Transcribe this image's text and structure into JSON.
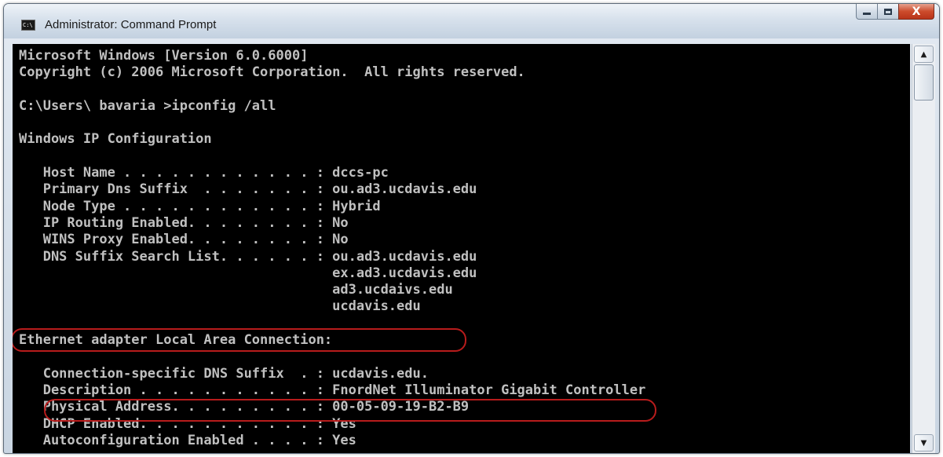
{
  "window": {
    "title": "Administrator: Command Prompt",
    "icon_label": "C:\\",
    "buttons": {
      "minimize": "minimize",
      "maximize": "maximize",
      "close": "X"
    }
  },
  "console": {
    "lines": [
      "Microsoft Windows [Version 6.0.6000]",
      "Copyright (c) 2006 Microsoft Corporation.  All rights reserved.",
      "",
      "C:\\Users\\ bavaria >ipconfig /all",
      "",
      "Windows IP Configuration",
      "",
      "   Host Name . . . . . . . . . . . . : dccs-pc",
      "   Primary Dns Suffix  . . . . . . . : ou.ad3.ucdavis.edu",
      "   Node Type . . . . . . . . . . . . : Hybrid",
      "   IP Routing Enabled. . . . . . . . : No",
      "   WINS Proxy Enabled. . . . . . . . : No",
      "   DNS Suffix Search List. . . . . . : ou.ad3.ucdavis.edu",
      "                                       ex.ad3.ucdavis.edu",
      "                                       ad3.ucdaivs.edu",
      "                                       ucdavis.edu",
      "",
      "Ethernet adapter Local Area Connection:",
      "",
      "   Connection-specific DNS Suffix  . : ucdavis.edu.",
      "   Description . . . . . . . . . . . : FnordNet Illuminator Gigabit Controller",
      "   Physical Address. . . . . . . . . : 00-05-09-19-B2-B9",
      "   DHCP Enabled. . . . . . . . . . . : Yes",
      "   Autoconfiguration Enabled . . . . : Yes"
    ],
    "highlighted_lines": [
      "Ethernet adapter Local Area Connection:",
      "Physical Address. . . . . . . . . : 00-05-09-19-B2-B9"
    ],
    "text_color": "#c0c0c0",
    "background_color": "#000000",
    "highlight_color": "#b81c1c"
  },
  "scrollbar": {
    "up_arrow": "▲",
    "down_arrow": "▼"
  }
}
